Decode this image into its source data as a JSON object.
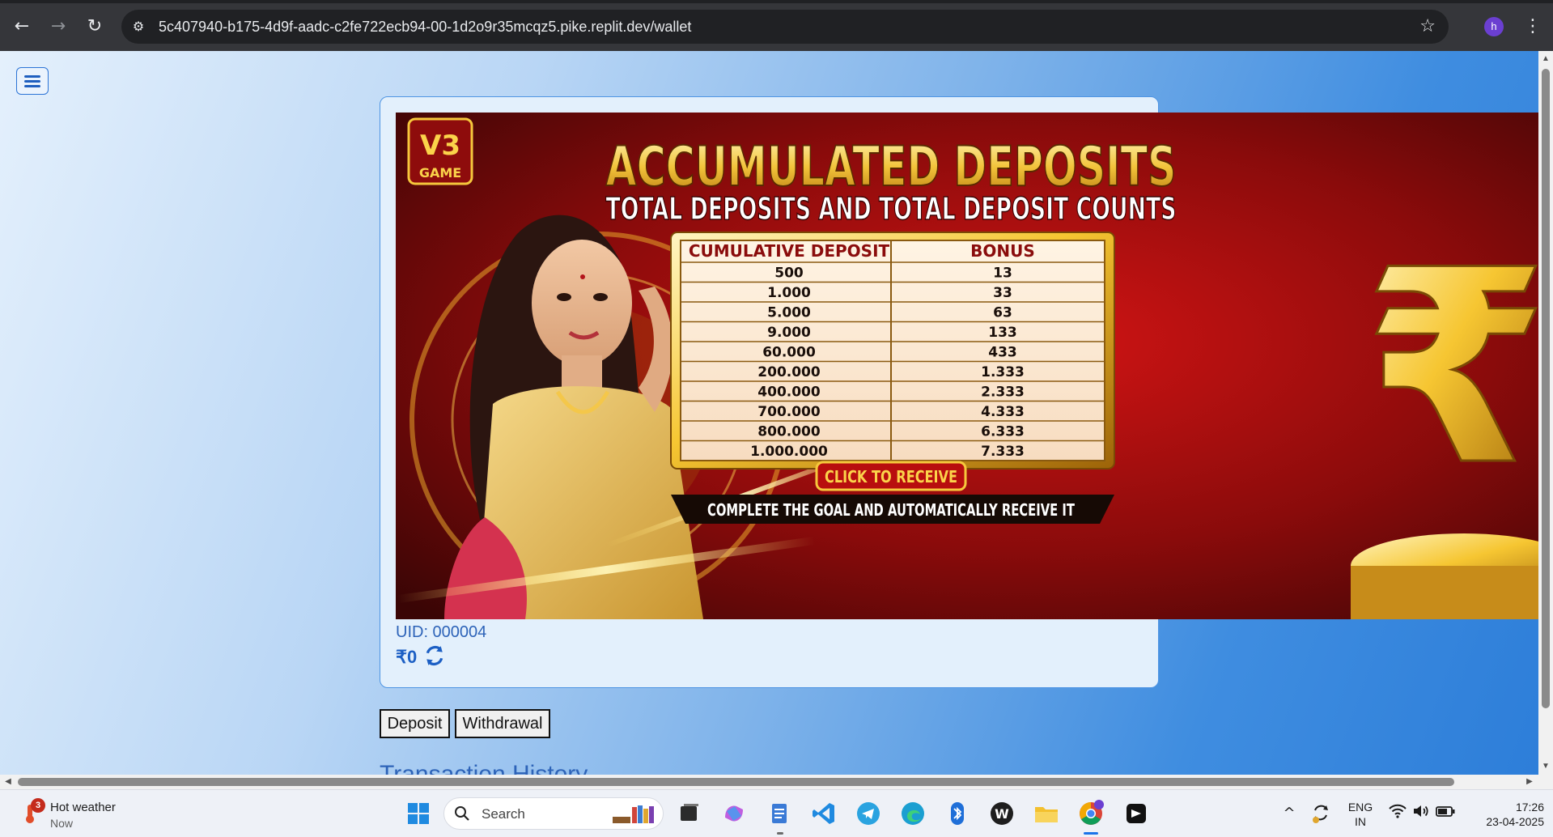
{
  "browser": {
    "url": "5c407940-b175-4d9f-aadc-c2fe722ecb94-00-1d2o9r35mcqz5.pike.replit.dev/wallet",
    "profile_initial": "h"
  },
  "banner": {
    "logo_top": "V3",
    "logo_bottom": "GAME",
    "headline": "ACCUMULATED DEPOSITS",
    "subheadline": "TOTAL DEPOSITS AND TOTAL DEPOSIT COUNTS",
    "table_headers": [
      "CUMULATIVE DEPOSIT",
      "BONUS"
    ],
    "rows": [
      {
        "deposit": "500",
        "bonus": "13"
      },
      {
        "deposit": "1.000",
        "bonus": "33"
      },
      {
        "deposit": "5.000",
        "bonus": "63"
      },
      {
        "deposit": "9.000",
        "bonus": "133"
      },
      {
        "deposit": "60.000",
        "bonus": "433"
      },
      {
        "deposit": "200.000",
        "bonus": "1.333"
      },
      {
        "deposit": "400.000",
        "bonus": "2.333"
      },
      {
        "deposit": "700.000",
        "bonus": "4.333"
      },
      {
        "deposit": "800.000",
        "bonus": "6.333"
      },
      {
        "deposit": "1.000.000",
        "bonus": "7.333"
      }
    ],
    "cta": "CLICK TO RECEIVE",
    "footer": "COMPLETE THE GOAL  AND AUTOMATICALLY RECEIVE IT"
  },
  "wallet": {
    "uid": "UID: 000004",
    "balance": "₹0"
  },
  "actions": {
    "deposit": "Deposit",
    "withdrawal": "Withdrawal"
  },
  "transaction_history_title": "Transaction History",
  "taskbar": {
    "weather_title": "Hot weather",
    "weather_sub": "Now",
    "weather_badge": "3",
    "search_label": "Search",
    "lang_top": "ENG",
    "lang_bottom": "IN",
    "time": "17:26",
    "date": "23-04-2025"
  }
}
